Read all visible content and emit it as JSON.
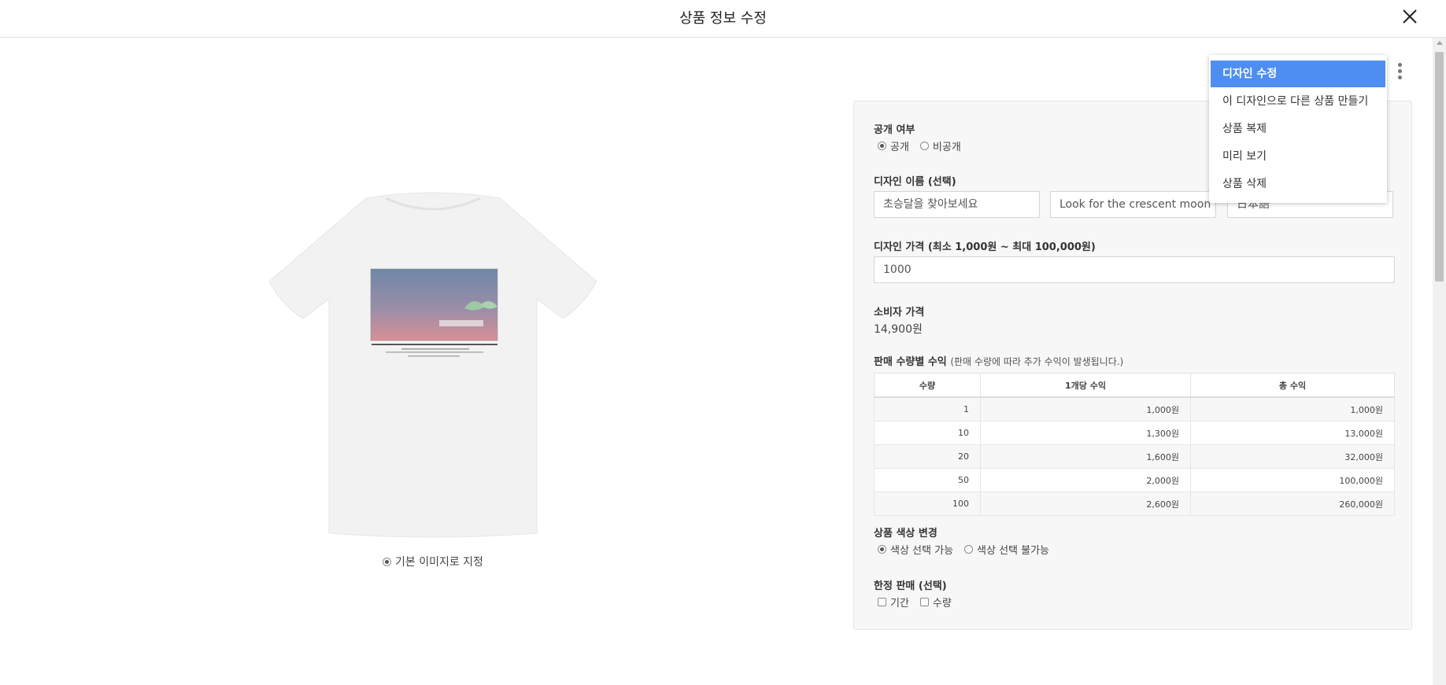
{
  "header": {
    "title": "상품 정보 수정"
  },
  "preview": {
    "default_image_label": "기본 이미지로 지정"
  },
  "panel": {
    "visibility": {
      "label": "공개 여부",
      "options": [
        "공개",
        "비공개"
      ],
      "selected": "공개"
    },
    "design_name": {
      "label": "디자인 이름 (선택)",
      "korean_value": "초승달을 찾아보세요",
      "english_value": "Look for the crescent moon pl",
      "japanese_value": "日本語"
    },
    "design_price": {
      "label": "디자인 가격 (최소 1,000원 ~ 최대 100,000원)",
      "value": "1000"
    },
    "consumer_price": {
      "label": "소비자 가격",
      "value": "14,900원"
    },
    "profit": {
      "label": "판매 수량별 수익",
      "note": "(판매 수량에 따라 추가 수익이 발생됩니다.)",
      "columns": [
        "수량",
        "1개당 수익",
        "총 수익"
      ],
      "rows": [
        [
          "1",
          "1,000원",
          "1,000원"
        ],
        [
          "10",
          "1,300원",
          "13,000원"
        ],
        [
          "20",
          "1,600원",
          "32,000원"
        ],
        [
          "50",
          "2,000원",
          "100,000원"
        ],
        [
          "100",
          "2,600원",
          "260,000원"
        ]
      ]
    },
    "color_change": {
      "label": "상품 색상 변경",
      "options": [
        "색상 선택 가능",
        "색상 선택 불가능"
      ],
      "selected": "색상 선택 가능"
    },
    "limited_sale": {
      "label": "한정 판매 (선택)",
      "options": [
        "기간",
        "수량"
      ]
    }
  },
  "menu": {
    "items": [
      "디자인 수정",
      "이 디자인으로 다른 상품 만들기",
      "상품 복제",
      "미리 보기",
      "상품 삭제"
    ],
    "active_index": 0
  },
  "colors": {
    "accent": "#4d8ef0",
    "shirt": "#f2f2f2"
  }
}
